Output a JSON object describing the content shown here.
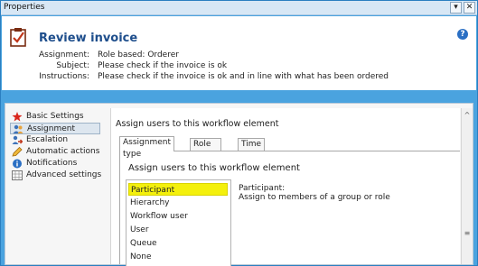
{
  "window": {
    "title": "Properties",
    "dropdown_glyph": "▾",
    "close_glyph": "✕"
  },
  "header": {
    "title": "Review invoice",
    "help_glyph": "?",
    "assignment_label": "Assignment:",
    "assignment_value": "Role based: Orderer",
    "subject_label": "Subject:",
    "subject_value": "Please check if the invoice is ok",
    "instructions_label": "Instructions:",
    "instructions_value": "Please check if the invoice is ok and in line with what has been ordered"
  },
  "nav": {
    "items": [
      {
        "label": "Basic Settings",
        "icon": "red-star-icon"
      },
      {
        "label": "Assignment",
        "icon": "users-icon",
        "selected": true
      },
      {
        "label": "Escalation",
        "icon": "escalation-icon"
      },
      {
        "label": "Automatic actions",
        "icon": "pencil-icon"
      },
      {
        "label": "Notifications",
        "icon": "info-icon"
      },
      {
        "label": "Advanced settings",
        "icon": "grid-icon"
      }
    ]
  },
  "content": {
    "heading": "Assign users to this workflow element",
    "tabs": [
      {
        "label": "Assignment type",
        "active": true
      },
      {
        "label": "Role based"
      },
      {
        "label": "Time limit"
      }
    ],
    "panel_heading": "Assign users to this workflow element",
    "list": {
      "items": [
        "Participant",
        "Hierarchy",
        "Workflow user",
        "User",
        "Queue",
        "None"
      ],
      "selected": "Participant"
    },
    "description_title": "Participant:",
    "description_text": "Assign to members of a group or role"
  },
  "scrollbar": {
    "up_glyph": "^",
    "grip_glyph": "≡"
  },
  "colors": {
    "window_border": "#4aa3df",
    "title_color": "#1e4e8c",
    "highlight": "#f4f00c"
  }
}
